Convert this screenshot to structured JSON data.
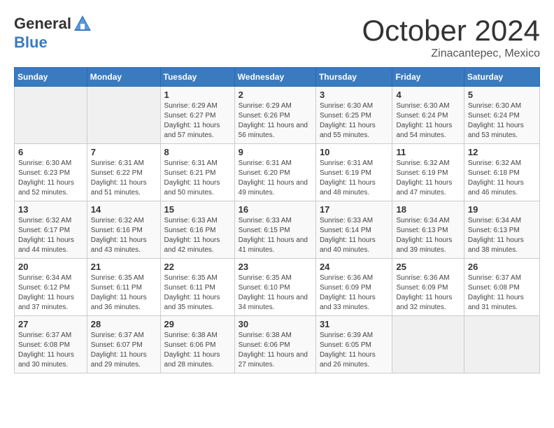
{
  "header": {
    "logo_general": "General",
    "logo_blue": "Blue",
    "month": "October 2024",
    "location": "Zinacantepec, Mexico"
  },
  "weekdays": [
    "Sunday",
    "Monday",
    "Tuesday",
    "Wednesday",
    "Thursday",
    "Friday",
    "Saturday"
  ],
  "weeks": [
    [
      {
        "day": "",
        "empty": true
      },
      {
        "day": "",
        "empty": true
      },
      {
        "day": "1",
        "sunrise": "6:29 AM",
        "sunset": "6:27 PM",
        "daylight": "11 hours and 57 minutes."
      },
      {
        "day": "2",
        "sunrise": "6:29 AM",
        "sunset": "6:26 PM",
        "daylight": "11 hours and 56 minutes."
      },
      {
        "day": "3",
        "sunrise": "6:30 AM",
        "sunset": "6:25 PM",
        "daylight": "11 hours and 55 minutes."
      },
      {
        "day": "4",
        "sunrise": "6:30 AM",
        "sunset": "6:24 PM",
        "daylight": "11 hours and 54 minutes."
      },
      {
        "day": "5",
        "sunrise": "6:30 AM",
        "sunset": "6:24 PM",
        "daylight": "11 hours and 53 minutes."
      }
    ],
    [
      {
        "day": "6",
        "sunrise": "6:30 AM",
        "sunset": "6:23 PM",
        "daylight": "11 hours and 52 minutes."
      },
      {
        "day": "7",
        "sunrise": "6:31 AM",
        "sunset": "6:22 PM",
        "daylight": "11 hours and 51 minutes."
      },
      {
        "day": "8",
        "sunrise": "6:31 AM",
        "sunset": "6:21 PM",
        "daylight": "11 hours and 50 minutes."
      },
      {
        "day": "9",
        "sunrise": "6:31 AM",
        "sunset": "6:20 PM",
        "daylight": "11 hours and 49 minutes."
      },
      {
        "day": "10",
        "sunrise": "6:31 AM",
        "sunset": "6:19 PM",
        "daylight": "11 hours and 48 minutes."
      },
      {
        "day": "11",
        "sunrise": "6:32 AM",
        "sunset": "6:19 PM",
        "daylight": "11 hours and 47 minutes."
      },
      {
        "day": "12",
        "sunrise": "6:32 AM",
        "sunset": "6:18 PM",
        "daylight": "11 hours and 46 minutes."
      }
    ],
    [
      {
        "day": "13",
        "sunrise": "6:32 AM",
        "sunset": "6:17 PM",
        "daylight": "11 hours and 44 minutes."
      },
      {
        "day": "14",
        "sunrise": "6:32 AM",
        "sunset": "6:16 PM",
        "daylight": "11 hours and 43 minutes."
      },
      {
        "day": "15",
        "sunrise": "6:33 AM",
        "sunset": "6:16 PM",
        "daylight": "11 hours and 42 minutes."
      },
      {
        "day": "16",
        "sunrise": "6:33 AM",
        "sunset": "6:15 PM",
        "daylight": "11 hours and 41 minutes."
      },
      {
        "day": "17",
        "sunrise": "6:33 AM",
        "sunset": "6:14 PM",
        "daylight": "11 hours and 40 minutes."
      },
      {
        "day": "18",
        "sunrise": "6:34 AM",
        "sunset": "6:13 PM",
        "daylight": "11 hours and 39 minutes."
      },
      {
        "day": "19",
        "sunrise": "6:34 AM",
        "sunset": "6:13 PM",
        "daylight": "11 hours and 38 minutes."
      }
    ],
    [
      {
        "day": "20",
        "sunrise": "6:34 AM",
        "sunset": "6:12 PM",
        "daylight": "11 hours and 37 minutes."
      },
      {
        "day": "21",
        "sunrise": "6:35 AM",
        "sunset": "6:11 PM",
        "daylight": "11 hours and 36 minutes."
      },
      {
        "day": "22",
        "sunrise": "6:35 AM",
        "sunset": "6:11 PM",
        "daylight": "11 hours and 35 minutes."
      },
      {
        "day": "23",
        "sunrise": "6:35 AM",
        "sunset": "6:10 PM",
        "daylight": "11 hours and 34 minutes."
      },
      {
        "day": "24",
        "sunrise": "6:36 AM",
        "sunset": "6:09 PM",
        "daylight": "11 hours and 33 minutes."
      },
      {
        "day": "25",
        "sunrise": "6:36 AM",
        "sunset": "6:09 PM",
        "daylight": "11 hours and 32 minutes."
      },
      {
        "day": "26",
        "sunrise": "6:37 AM",
        "sunset": "6:08 PM",
        "daylight": "11 hours and 31 minutes."
      }
    ],
    [
      {
        "day": "27",
        "sunrise": "6:37 AM",
        "sunset": "6:08 PM",
        "daylight": "11 hours and 30 minutes."
      },
      {
        "day": "28",
        "sunrise": "6:37 AM",
        "sunset": "6:07 PM",
        "daylight": "11 hours and 29 minutes."
      },
      {
        "day": "29",
        "sunrise": "6:38 AM",
        "sunset": "6:06 PM",
        "daylight": "11 hours and 28 minutes."
      },
      {
        "day": "30",
        "sunrise": "6:38 AM",
        "sunset": "6:06 PM",
        "daylight": "11 hours and 27 minutes."
      },
      {
        "day": "31",
        "sunrise": "6:39 AM",
        "sunset": "6:05 PM",
        "daylight": "11 hours and 26 minutes."
      },
      {
        "day": "",
        "empty": true
      },
      {
        "day": "",
        "empty": true
      }
    ]
  ],
  "labels": {
    "sunrise": "Sunrise:",
    "sunset": "Sunset:",
    "daylight": "Daylight:"
  }
}
